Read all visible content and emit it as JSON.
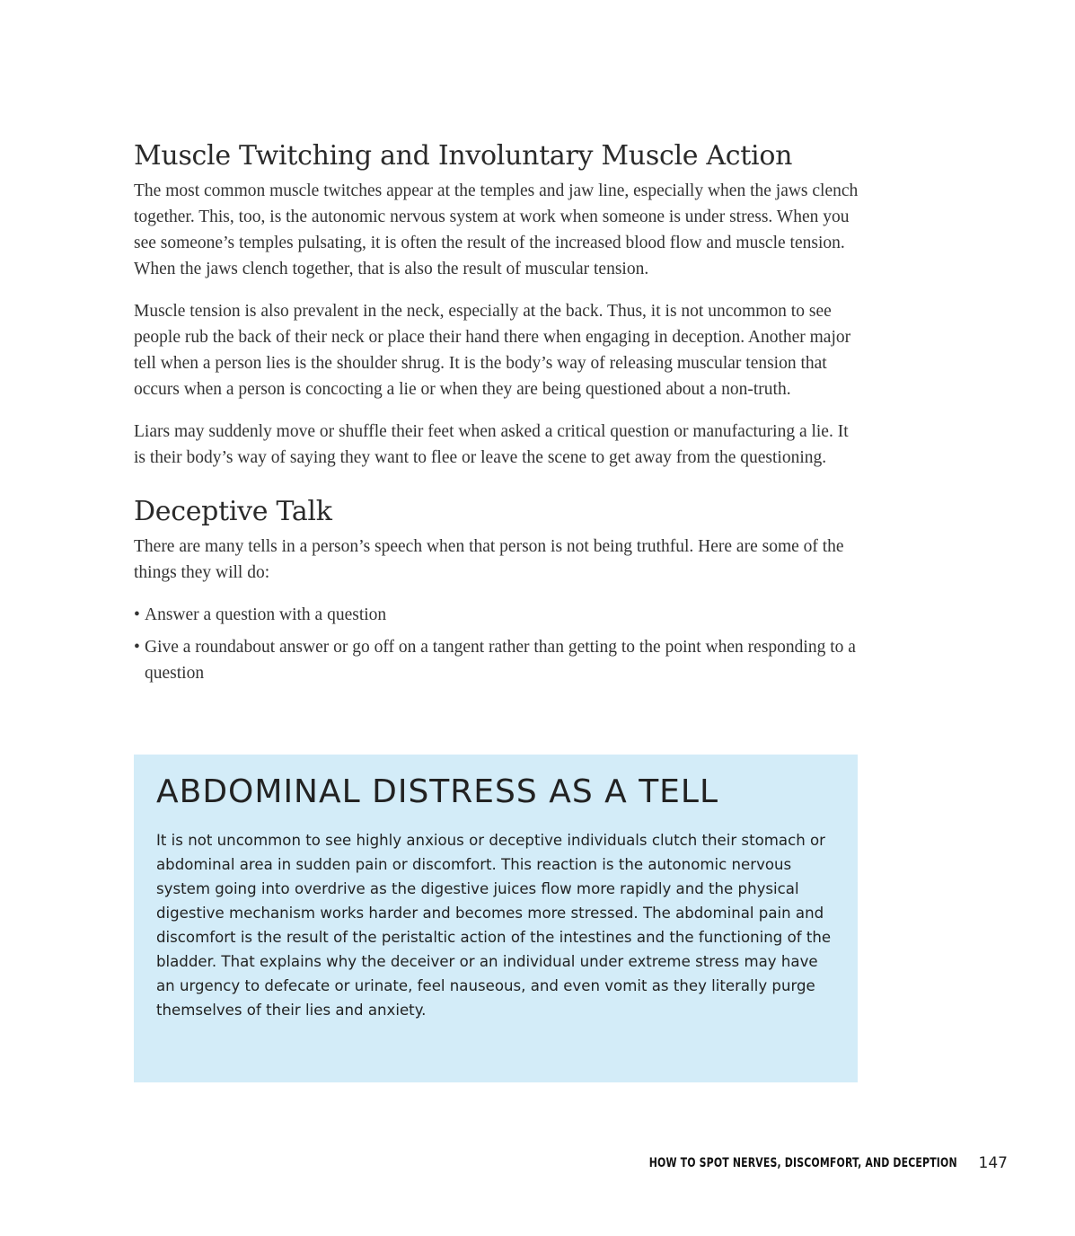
{
  "section1": {
    "heading": "Muscle Twitching and Involuntary Muscle Action",
    "paragraphs": [
      "The most common muscle twitches appear at the temples and jaw line, especially when the jaws clench together. This, too, is the autonomic nervous system at work when someone is under stress. When you see someone’s temples pulsating, it is often the result of the increased blood flow and muscle tension. When the jaws clench together, that is also the result of muscular tension.",
      "Muscle tension is also prevalent in the neck, especially at the back. Thus, it is not uncommon to see people rub the back of their neck or place their hand there when engaging in deception. Another major tell when a person lies is the shoulder shrug. It is the body’s way of releasing muscular tension that occurs when a person is concocting a lie or when they are being questioned about a non-truth.",
      "Liars may suddenly move or shuffle their feet when asked a critical question or manufacturing a lie. It is their body’s way of saying they want to flee or leave the scene to get away from the questioning."
    ]
  },
  "section2": {
    "heading": "Deceptive Talk",
    "intro": "There are many tells in a person’s speech when that person is not being truthful. Here are some of the things they will do:",
    "bullet_char": "•",
    "bullets": [
      "Answer a question with a question",
      "Give a roundabout answer or go off on a tangent rather than getting to the point when responding to a question"
    ]
  },
  "sidebar": {
    "heading": "ABDOMINAL DISTRESS AS A TELL",
    "body": "It is not uncommon to see highly anxious or deceptive individuals clutch their stomach or abdominal area in sudden pain or discomfort. This reaction is the autonomic nervous system going into overdrive as the digestive juices flow more rapidly and the physical digestive mechanism works harder and becomes more stressed. The abdominal pain and discomfort is the result of the peristaltic action of the intestines and the functioning of the bladder. That explains why the deceiver or an individual under extreme stress may have an urgency to defecate or urinate, feel nauseous, and even vomit as they literally purge themselves of their lies and anxiety.",
    "background_color": "#d3ecf8"
  },
  "footer": {
    "running_title": "HOW TO SPOT NERVES, DISCOMFORT, AND DECEPTION",
    "page_number": "147"
  }
}
